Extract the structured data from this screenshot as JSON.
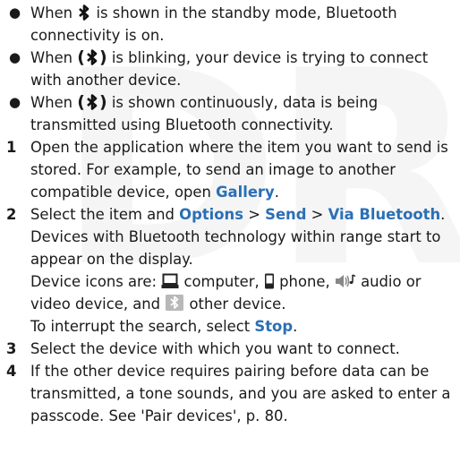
{
  "watermark": "DR",
  "colors": {
    "highlight": "#2b6fb5",
    "text": "#1a1a1a",
    "watermark": "#f5f5f5"
  },
  "icons": [
    "bluetooth-icon",
    "computer-icon",
    "phone-icon",
    "audio-video-icon",
    "other-device-icon"
  ],
  "bullets": {
    "b1": {
      "a": "When ",
      "b": " is shown in the standby mode, Bluetooth connectivity is on."
    },
    "b2": {
      "open": "(",
      "close": ")",
      "b": " is blinking, your device is trying to connect with another device."
    },
    "b3": {
      "open": "(",
      "close": ")",
      "b": " is shown continuously, data is being transmitted using Bluetooth connectivity."
    }
  },
  "steps": {
    "s1": {
      "num": "1",
      "text": "Open the application where the item you want to send is stored. For example, to send an image to another compatible device, open ",
      "link": "Gallery",
      "end": "."
    },
    "s2": {
      "num": "2",
      "a": "Select the item and ",
      "options": "Options",
      "sep1": " > ",
      "send": "Send",
      "sep2": " > ",
      "via": "Via Bluetooth",
      "end": ".",
      "p1": "Devices with Bluetooth technology within range start to appear on the display.",
      "icons_intro": "Device icons are: ",
      "computer": " computer, ",
      "phone": " phone, ",
      "audio": " audio or video device, and ",
      "other": " other device.",
      "interrupt": "To interrupt the search, select ",
      "stop": "Stop",
      "interrupt_end": "."
    },
    "s3": {
      "num": "3",
      "text": "Select the device with which you want to connect."
    },
    "s4": {
      "num": "4",
      "text": "If the other device requires pairing before data can be transmitted, a tone sounds, and you are asked to enter a passcode. See 'Pair devices', p. 80."
    }
  }
}
